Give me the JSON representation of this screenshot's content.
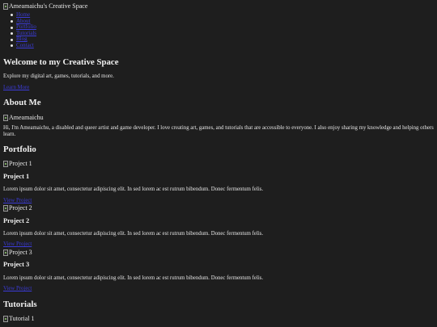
{
  "header": {
    "logo_alt": "Ameamaichu's Creative Space",
    "nav": [
      "Home",
      "About",
      "Portfolio",
      "Tutorials",
      "Blog",
      "Contact"
    ]
  },
  "hero": {
    "title": "Welcome to my Creative Space",
    "text": "Explore my digital art, games, tutorials, and more.",
    "link": "Learn More"
  },
  "about": {
    "title": "About Me",
    "img_alt": "Ameamaichu",
    "text": "Hi, I'm Ameamaichu, a disabled and queer artist and game developer. I love creating art, games, and tutorials that are accessible to everyone. I also enjoy sharing my knowledge and helping others learn."
  },
  "portfolio": {
    "title": "Portfolio",
    "projects": [
      {
        "img_alt": "Project 1",
        "title": "Project 1",
        "text": "Lorem ipsum dolor sit amet, consectetur adipiscing elit. In sed lorem ac est rutrum bibendum. Donec fermentum felis.",
        "link": "View Project"
      },
      {
        "img_alt": "Project 2",
        "title": "Project 2",
        "text": "Lorem ipsum dolor sit amet, consectetur adipiscing elit. In sed lorem ac est rutrum bibendum. Donec fermentum felis.",
        "link": "View Project"
      },
      {
        "img_alt": "Project 3",
        "title": "Project 3",
        "text": "Lorem ipsum dolor sit amet, consectetur adipiscing elit. In sed lorem ac est rutrum bibendum. Donec fermentum felis.",
        "link": "View Project"
      }
    ]
  },
  "tutorials": {
    "title": "Tutorials",
    "first_img_alt": "Tutorial 1"
  },
  "colors": {
    "background": "#1e1e1e",
    "text": "#e8e8e8",
    "link": "#3b3bd8"
  }
}
